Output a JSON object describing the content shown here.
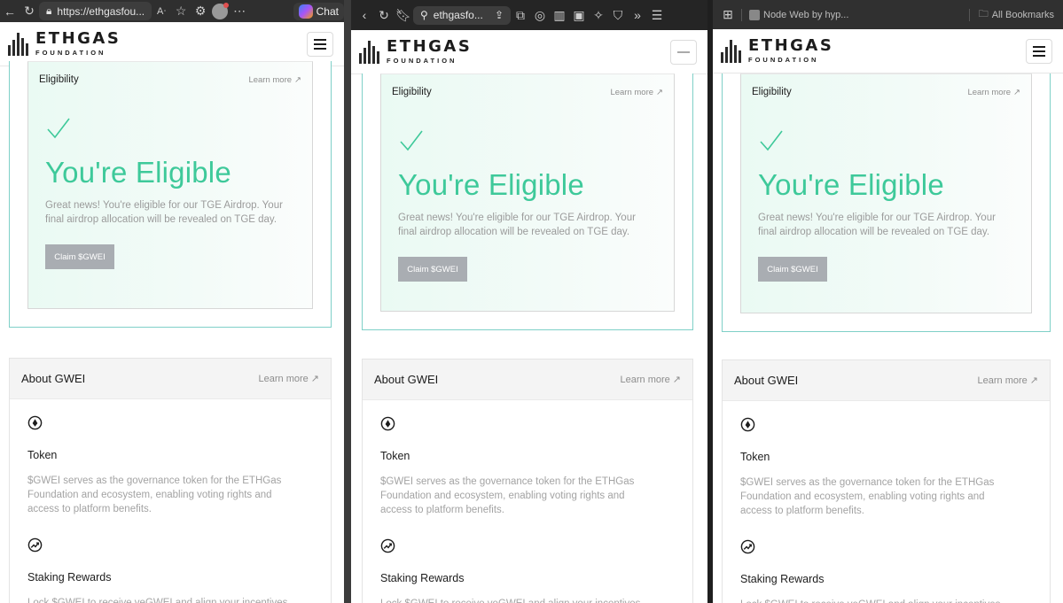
{
  "panels": [
    {
      "browser": {
        "url": "https://ethgasfou...",
        "chat_label": "Chat"
      }
    },
    {
      "browser": {
        "url": "ethgasfo..."
      }
    },
    {
      "browser": {
        "tab_title": "Node Web by hyp...",
        "bookmarks_label": "All Bookmarks"
      }
    }
  ],
  "site": {
    "logo": {
      "name": "ETHGAS",
      "sub": "FOUNDATION"
    },
    "eligibility": {
      "title": "Eligibility",
      "learn_more": "Learn more",
      "headline": "You're Eligible",
      "description": "Great news! You're eligible for our TGE Airdrop. Your final airdrop allocation will be revealed on TGE day.",
      "claim_button": "Claim $GWEI",
      "accent_color": "#3ec99a",
      "border_color": "#7fd0c8"
    },
    "about": {
      "title": "About GWEI",
      "learn_more": "Learn more",
      "features": [
        {
          "icon": "token-icon",
          "title": "Token",
          "description": "$GWEI serves as the governance token for the ETHGas Foundation and ecosystem, enabling voting rights and access to platform benefits."
        },
        {
          "icon": "trending-up-icon",
          "title": "Staking Rewards",
          "description": "Lock $GWEI to receive veGWEI and align your incentives"
        }
      ]
    }
  }
}
